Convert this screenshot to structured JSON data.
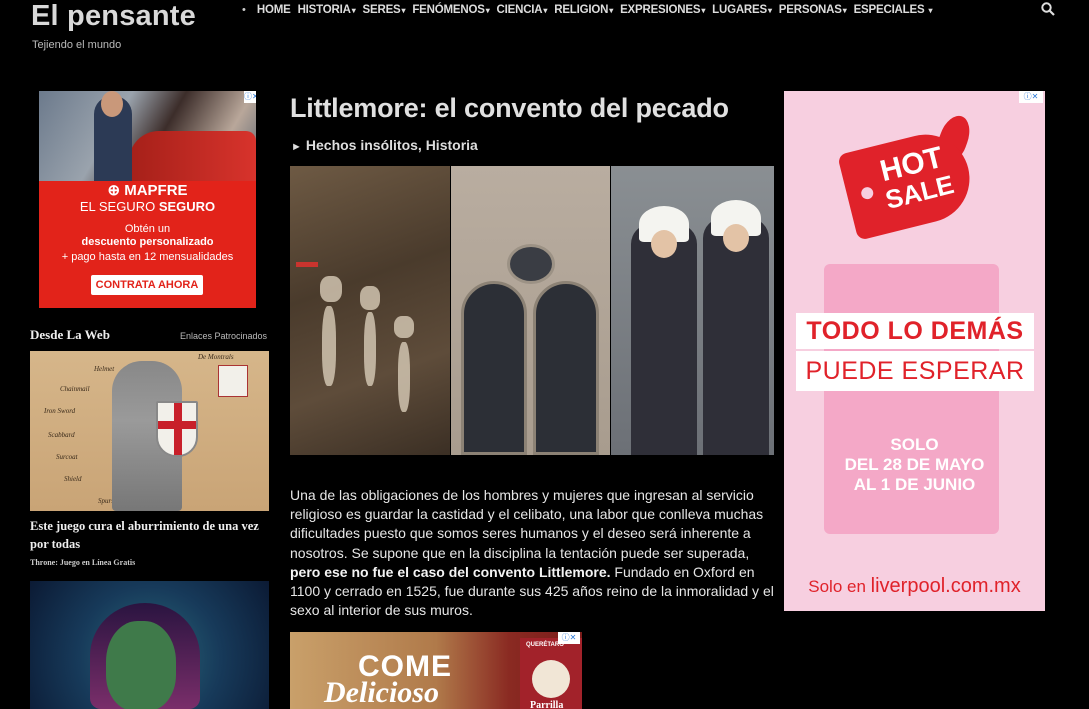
{
  "header": {
    "site_title": "El pensante",
    "tagline": "Tejiendo el mundo",
    "nav_bullet": "•",
    "nav": [
      {
        "label": "HOME",
        "caret": ""
      },
      {
        "label": "HISTORIA",
        "caret": "▾"
      },
      {
        "label": "SERES",
        "caret": "▾"
      },
      {
        "label": "FENÓMENOS",
        "caret": "▾"
      },
      {
        "label": "CIENCIA",
        "caret": "▾"
      },
      {
        "label": "RELIGION",
        "caret": "▾"
      },
      {
        "label": "EXPRESIONES",
        "caret": "▾"
      },
      {
        "label": "LUGARES",
        "caret": "▾"
      },
      {
        "label": "PERSONAS",
        "caret": "▾"
      },
      {
        "label": "ESPECIALES",
        "caret": "▾"
      }
    ],
    "search_icon": "search-icon"
  },
  "ads": {
    "mapfre": {
      "brand": "MAPFRE",
      "line_seguro_a": "EL SEGURO",
      "line_seguro_b": "SEGURO",
      "line1": "Obtén un",
      "line2": "descuento personalizado",
      "line3": "+ pago hasta en 12 mensualidades",
      "cta": "CONTRATA AHORA"
    },
    "hotsale": {
      "hot": "HOT",
      "sale": "SALE",
      "todo": "TODO LO DEMÁS",
      "puede": "PUEDE ESPERAR",
      "solo_lines": [
        "SOLO",
        "DEL 28 DE MAYO",
        "AL 1 DE JUNIO"
      ],
      "footer_prefix": "Solo en",
      "footer_brand": "liverpool.com.mx"
    },
    "come": {
      "come": "COME",
      "delicioso": "Delicioso",
      "region": "QUERÉTARO",
      "brand": "Parrilla"
    },
    "choice_icon": "ⓘ✕"
  },
  "sidebar": {
    "heading": "Desde La Web",
    "sponsored": "Enlaces Patrocinados",
    "items": [
      {
        "title": "Este juego cura el aburrimiento de una vez por todas",
        "source": "Throne: Juego en Línea Gratis"
      }
    ],
    "knight_labels": [
      "Helmet",
      "Chainmail",
      "Iron Sword",
      "Scabbard",
      "Surcoat",
      "Shield",
      "Spurs",
      "De Montrals"
    ]
  },
  "article": {
    "title": "Littlemore: el convento del pecado",
    "category_arrow": "►",
    "categories": "Hechos insólitos, Historia",
    "body_before": "Una de las obligaciones de los hombres y mujeres que ingresan al servicio religioso es guardar la castidad y el celibato, una labor que conlleva muchas dificultades puesto que somos seres humanos y el deseo será inherente a nosotros. Se supone que en la disciplina la tentación puede ser superada, ",
    "body_bold": "pero ese no fue el caso del convento Littlemore.",
    "body_after": " Fundado en Oxford en 1100 y cerrado en 1525, fue durante sus 425 años reino de la inmoralidad y el sexo al interior de sus muros."
  }
}
